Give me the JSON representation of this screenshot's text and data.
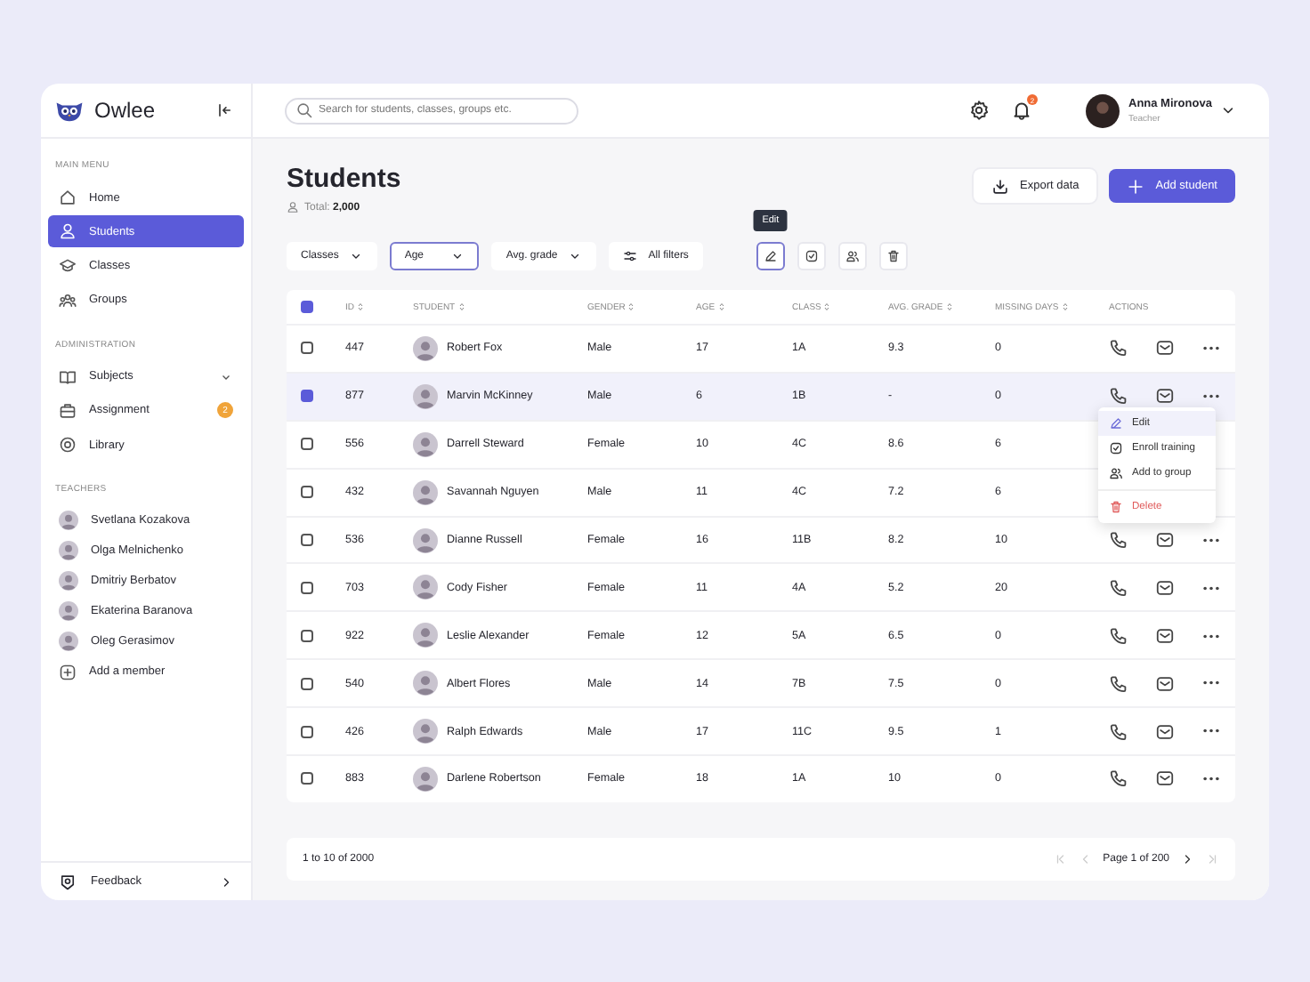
{
  "sidebar": {
    "brand": "Owlee",
    "sections": [
      {
        "title": "MAIN MENU",
        "items": [
          {
            "label": "Home",
            "selected": false
          },
          {
            "label": "Students",
            "selected": true
          },
          {
            "label": "Classes",
            "selected": false
          },
          {
            "label": "Groups",
            "selected": false
          }
        ]
      },
      {
        "title": "ADMINISTRATION",
        "items": [
          {
            "label": "Subjects",
            "selected": false,
            "expandable": true
          },
          {
            "label": "Assignment",
            "selected": false,
            "badge": "2"
          },
          {
            "label": "Library",
            "selected": false
          }
        ]
      }
    ],
    "teachers_title": "TEACHERS",
    "teachers": [
      {
        "name": "Svetlana Kozakova"
      },
      {
        "name": "Olga Melnichenko"
      },
      {
        "name": "Dmitriy Berbatov"
      },
      {
        "name": "Ekaterina Baranova"
      },
      {
        "name": "Oleg Gerasimov"
      }
    ],
    "add_member": "Add a member",
    "feedback": "Feedback"
  },
  "topbar": {
    "search": {
      "placeholder": "Search for students, classes, groups etc."
    },
    "notifications_badge": "2",
    "user": {
      "name": "Anna Mironova",
      "role": "Teacher"
    }
  },
  "page": {
    "title": "Students",
    "total_label": "Total:",
    "total": "2,000",
    "export_button": "Export data",
    "add_button": "Add student"
  },
  "filters": [
    {
      "kind": "dropdown",
      "label": "Classes",
      "selected": false
    },
    {
      "kind": "dropdown",
      "label": "Age",
      "selected": true
    },
    {
      "kind": "dropdown",
      "label": "Avg. grade",
      "selected": false
    },
    {
      "kind": "button",
      "label": "All filters",
      "selected": false
    }
  ],
  "tool_buttons": [
    {
      "selected": true
    },
    {
      "selected": false
    },
    {
      "selected": false
    },
    {
      "selected": false
    }
  ],
  "tooltip": "Edit",
  "table": {
    "header_checkbox": {
      "checked": true
    },
    "columns": [
      {
        "label": "ID",
        "sortable": true
      },
      {
        "label": "STUDENT",
        "sortable": true
      },
      {
        "label": "GENDER",
        "sortable": true
      },
      {
        "label": "AGE",
        "sortable": true
      },
      {
        "label": "CLASS",
        "sortable": true
      },
      {
        "label": "AVG. GRADE",
        "sortable": true
      },
      {
        "label": "MISSING DAYS",
        "sortable": true
      },
      {
        "label": "ACTIONS",
        "sortable": false
      }
    ],
    "rows": [
      {
        "id": "447",
        "student": "Robert Fox",
        "gender": "Male",
        "age": "17",
        "class": "1A",
        "avg_grade": "9.3",
        "missing_days": "0",
        "selected": false
      },
      {
        "id": "877",
        "student": "Marvin McKinney",
        "gender": "Male",
        "age": "6",
        "class": "1B",
        "avg_grade": "-",
        "missing_days": "0",
        "selected": true,
        "menu": [
          {
            "kind": "normal",
            "label": "Edit",
            "selected": true
          },
          {
            "kind": "normal",
            "label": "Enroll training",
            "selected": false
          },
          {
            "kind": "normal",
            "label": "Add to group",
            "selected": false
          },
          {
            "kind": "danger",
            "label": "Delete",
            "selected": false
          }
        ]
      },
      {
        "id": "556",
        "student": "Darrell Steward",
        "gender": "Female",
        "age": "10",
        "class": "4C",
        "avg_grade": "8.6",
        "missing_days": "6",
        "selected": false
      },
      {
        "id": "432",
        "student": "Savannah Nguyen",
        "gender": "Male",
        "age": "11",
        "class": "4C",
        "avg_grade": "7.2",
        "missing_days": "6",
        "selected": false
      },
      {
        "id": "536",
        "student": "Dianne Russell",
        "gender": "Female",
        "age": "16",
        "class": "11B",
        "avg_grade": "8.2",
        "missing_days": "10",
        "selected": false
      },
      {
        "id": "703",
        "student": "Cody Fisher",
        "gender": "Female",
        "age": "11",
        "class": "4A",
        "avg_grade": "5.2",
        "missing_days": "20",
        "selected": false
      },
      {
        "id": "922",
        "student": "Leslie Alexander",
        "gender": "Female",
        "age": "12",
        "class": "5A",
        "avg_grade": "6.5",
        "missing_days": "0",
        "selected": false
      },
      {
        "id": "540",
        "student": "Albert Flores",
        "gender": "Male",
        "age": "14",
        "class": "7B",
        "avg_grade": "7.5",
        "missing_days": "0",
        "selected": false
      },
      {
        "id": "426",
        "student": "Ralph Edwards",
        "gender": "Male",
        "age": "17",
        "class": "11C",
        "avg_grade": "9.5",
        "missing_days": "1",
        "selected": false
      },
      {
        "id": "883",
        "student": "Darlene Robertson",
        "gender": "Female",
        "age": "18",
        "class": "1A",
        "avg_grade": "10",
        "missing_days": "0",
        "selected": false
      }
    ]
  },
  "pagination": {
    "range": "1 to 10 of 2000",
    "page": "Page 1 of 200"
  }
}
